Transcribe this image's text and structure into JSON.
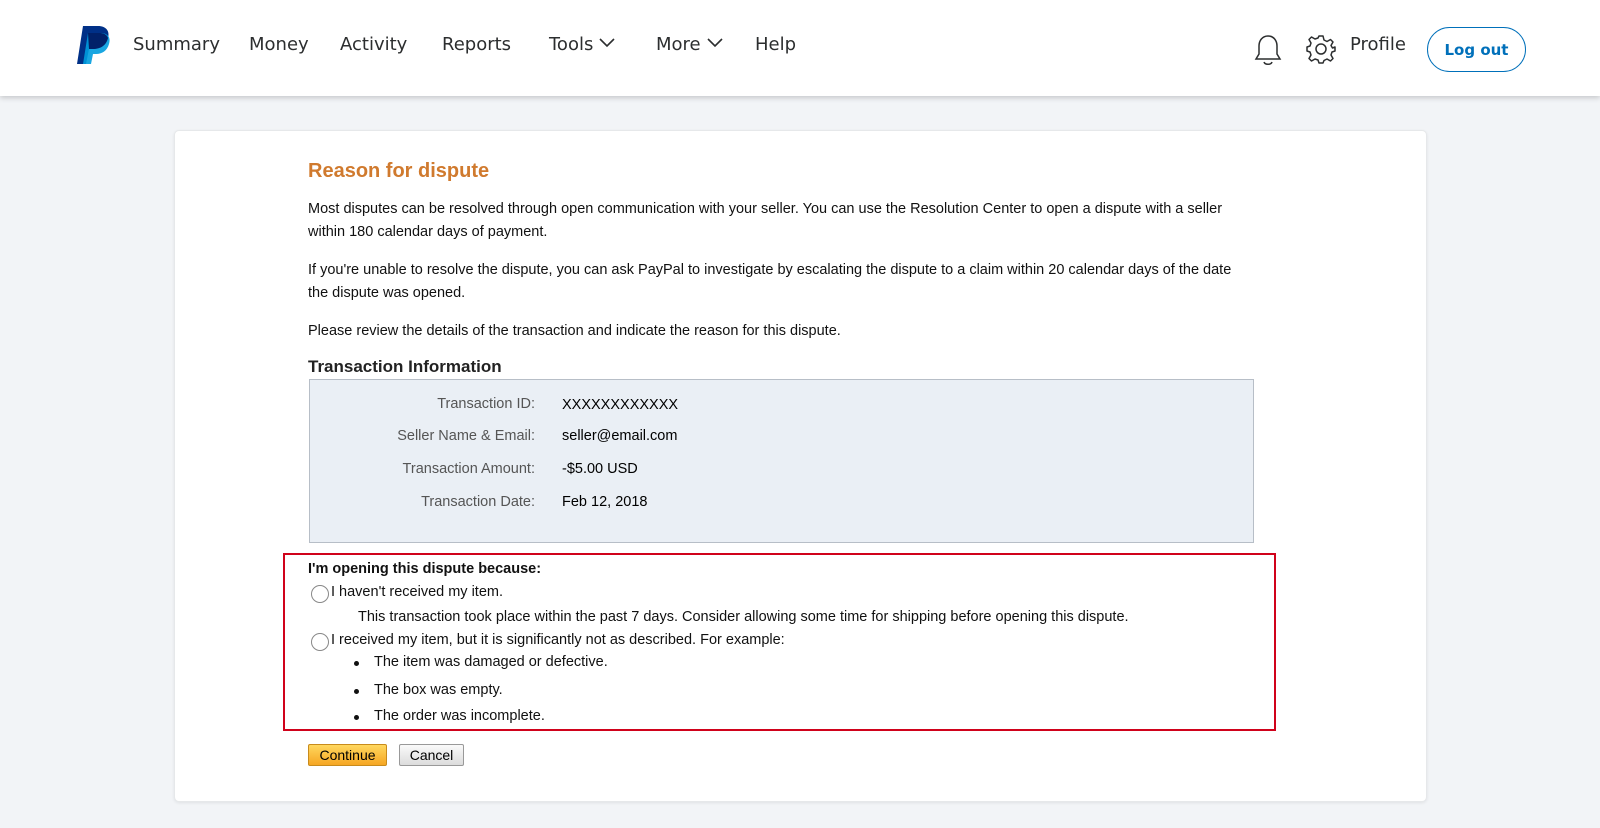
{
  "header": {
    "nav": [
      {
        "label": "Summary"
      },
      {
        "label": "Money"
      },
      {
        "label": "Activity"
      },
      {
        "label": "Reports"
      },
      {
        "label": "Tools"
      },
      {
        "label": "More"
      },
      {
        "label": "Help"
      }
    ],
    "profile_label": "Profile",
    "logout_label": "Log out"
  },
  "dispute": {
    "title": "Reason for dispute",
    "paragraphs": [
      "Most disputes can be resolved through open communication with your seller. You can use the Resolution Center to open a dispute with a seller within 180 calendar days of payment.",
      "If you're unable to resolve the dispute, you can ask PayPal to investigate by escalating the dispute to a claim within 20 calendar days of the date the dispute was opened.",
      "Please review the details of the transaction and indicate the reason for this dispute."
    ],
    "transaction": {
      "heading": "Transaction Information",
      "rows": [
        {
          "label": "Transaction ID:",
          "value": "XXXXXXXXXXXX"
        },
        {
          "label": "Seller Name & Email:",
          "value": "seller@email.com"
        },
        {
          "label": "Transaction Amount:",
          "value": "-$5.00 USD"
        },
        {
          "label": "Transaction Date:",
          "value": "Feb 12, 2018"
        }
      ]
    },
    "reason": {
      "question": "I'm opening this dispute because:",
      "option1": "I haven't received my item.",
      "option1_note": "This transaction took place within the past 7 days. Consider allowing some time for shipping before opening this dispute.",
      "option2": "I received my item, but it is significantly not as described. For example:",
      "examples": [
        "The item was damaged or defective.",
        "The box was empty.",
        "The order was incomplete."
      ]
    },
    "buttons": {
      "continue": "Continue",
      "cancel": "Cancel"
    }
  },
  "colors": {
    "title": "#d07a2e",
    "brand_blue": "#0070ba",
    "highlight_border": "#d0021b",
    "info_box_bg": "#eaeff5"
  },
  "icons": [
    "paypal-logo",
    "chevron-down-icon",
    "bell-icon",
    "gear-icon"
  ]
}
